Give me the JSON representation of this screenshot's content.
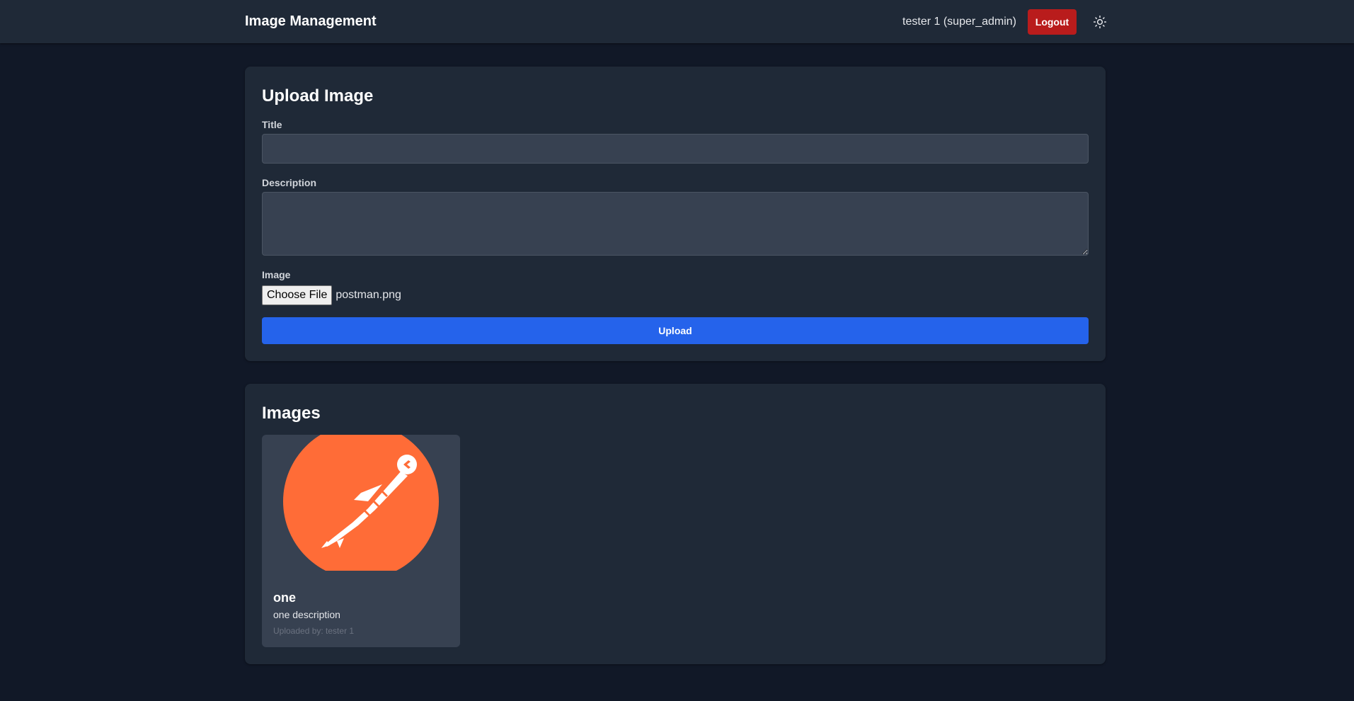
{
  "header": {
    "title": "Image Management",
    "user": "tester 1 (super_admin)",
    "logout_label": "Logout",
    "theme_icon": "sun-icon"
  },
  "upload": {
    "title": "Upload Image",
    "title_label": "Title",
    "title_value": "",
    "description_label": "Description",
    "description_value": "",
    "image_label": "Image",
    "choose_file_label": "Choose File",
    "file_name": "postman.png",
    "submit_label": "Upload"
  },
  "images": {
    "title": "Images",
    "items": [
      {
        "title": "one",
        "description": "one description",
        "uploaded_by": "Uploaded by: tester 1",
        "icon": "postman-logo"
      }
    ]
  },
  "colors": {
    "background": "#111827",
    "card": "#1f2937",
    "input": "#374151",
    "primary": "#2563eb",
    "danger": "#b91c1c",
    "logo_orange": "#ff6c37"
  }
}
